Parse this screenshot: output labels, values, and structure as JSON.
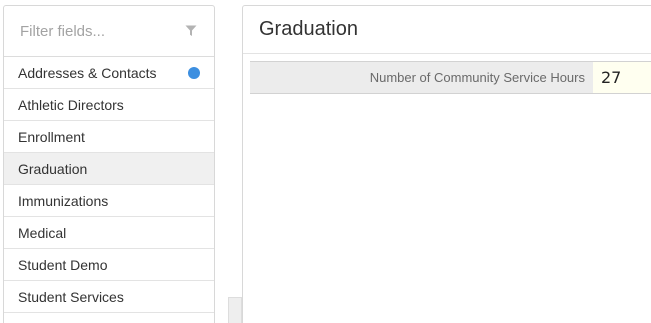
{
  "filter": {
    "placeholder": "Filter fields..."
  },
  "sidebar": {
    "items": [
      {
        "label": "Addresses & Contacts",
        "has_indicator": true
      },
      {
        "label": "Athletic Directors"
      },
      {
        "label": "Enrollment"
      },
      {
        "label": "Graduation",
        "active": true
      },
      {
        "label": "Immunizations"
      },
      {
        "label": "Medical"
      },
      {
        "label": "Student Demo"
      },
      {
        "label": "Student Services"
      }
    ]
  },
  "main": {
    "title": "Graduation",
    "fields": [
      {
        "label": "Number of Community Service Hours",
        "value": "27"
      }
    ]
  },
  "icons": {
    "filter": "filter-funnel-icon",
    "indicator": "status-dot-icon"
  },
  "colors": {
    "indicator": "#3d8fe0",
    "active_item_bg": "#f0f0f0",
    "label_bg": "#ececec",
    "value_bg": "#fffff0"
  }
}
